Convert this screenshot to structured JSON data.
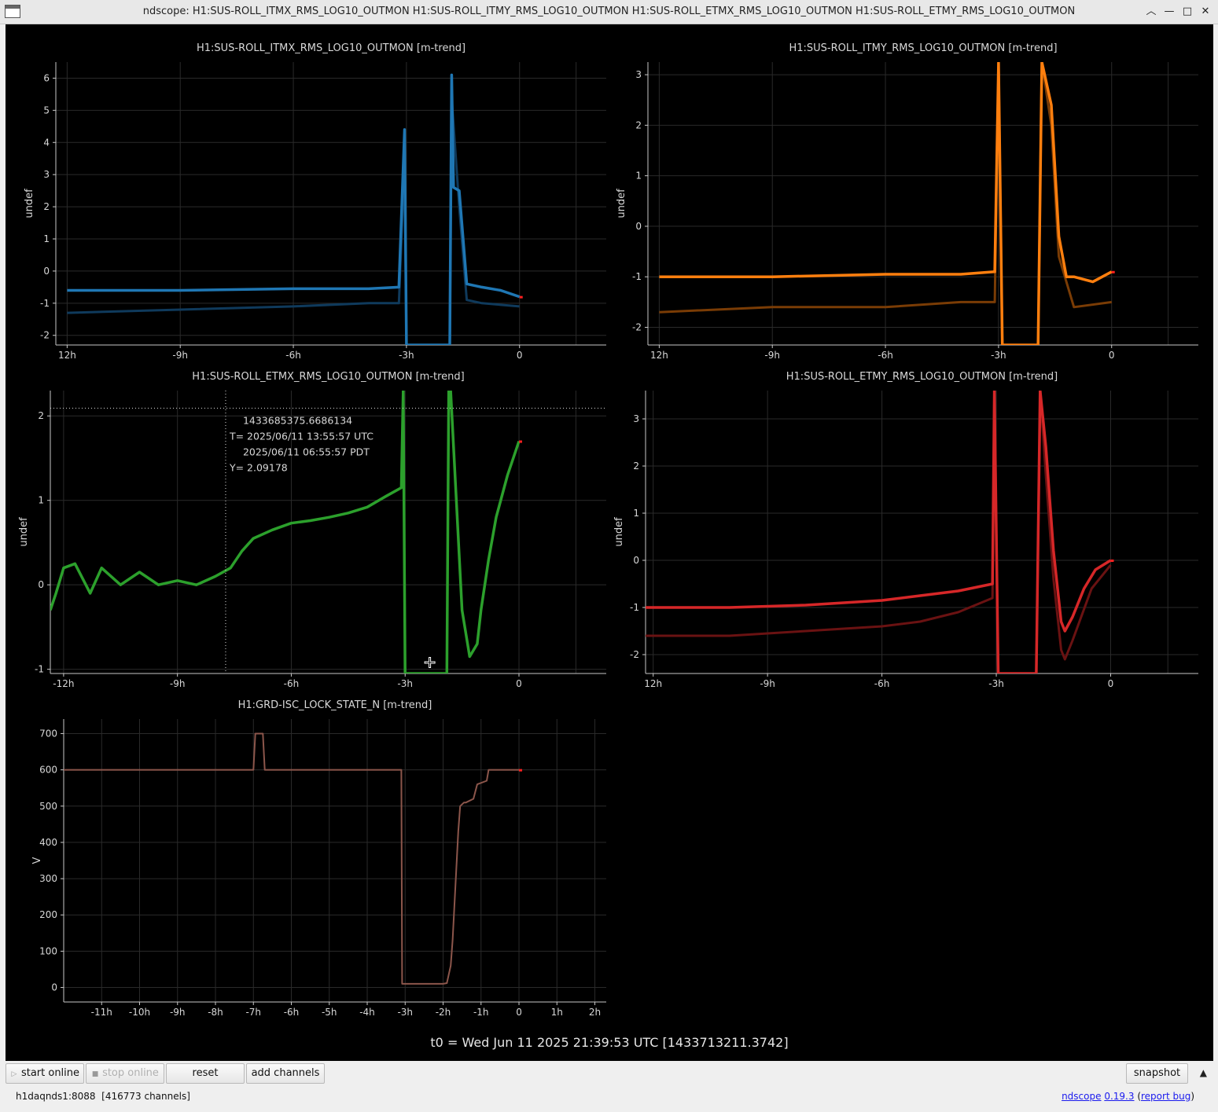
{
  "window": {
    "title": "ndscope: H1:SUS-ROLL_ITMX_RMS_LOG10_OUTMON H1:SUS-ROLL_ITMY_RMS_LOG10_OUTMON H1:SUS-ROLL_ETMX_RMS_LOG10_OUTMON H1:SUS-ROLL_ETMY_RMS_LOG10_OUTMON",
    "controls": [
      "︿",
      "—",
      "□",
      "✕"
    ]
  },
  "t0_label": "t0 = Wed Jun 11 2025 21:39:53 UTC [1433713211.3742]",
  "cursor_readout": {
    "gps": "1433685375.6686134",
    "utc": "T= 2025/06/11 13:55:57 UTC",
    "pdt": "2025/06/11 06:55:57 PDT",
    "y": "Y= 2.09178"
  },
  "buttons": {
    "start_online": "start online",
    "stop_online": "stop online",
    "reset": "reset",
    "add_channels": "add channels",
    "snapshot": "snapshot"
  },
  "status": {
    "server": "h1daqnds1:8088",
    "channels": "[416773 channels]",
    "app_name": "ndscope",
    "version": "0.19.3",
    "report_bug": "report bug"
  },
  "colors": {
    "itmx": "#1f77b4",
    "itmy": "#ff7f0e",
    "etmx": "#2ca02c",
    "etmy": "#d62728",
    "grd": "#8c564b",
    "background": "#000000",
    "text": "#d8d8d8"
  },
  "chart_data": [
    {
      "type": "line",
      "title": "H1:SUS-ROLL_ITMX_RMS_LOG10_OUTMON [m-trend]",
      "ylabel": "undef",
      "xlabel": "",
      "xlim": [
        -12.3,
        2.3
      ],
      "ylim": [
        -2.3,
        6.5
      ],
      "xticks": [
        -12,
        -9,
        -6,
        -3,
        0
      ],
      "xticklabels": [
        "12h",
        "-9h",
        "-6h",
        "-3h",
        "0"
      ],
      "yticks": [
        -2,
        -1,
        0,
        1,
        2,
        3,
        4,
        5,
        6
      ],
      "grid": true,
      "series": [
        {
          "role": "mean",
          "x": [
            -12,
            -9,
            -6,
            -4,
            -3.2,
            -3.05,
            -3,
            -2.95,
            -1.85,
            -1.8,
            -1.75,
            -1.6,
            -1.4,
            -1,
            -0.5,
            0
          ],
          "y": [
            -0.6,
            -0.6,
            -0.55,
            -0.55,
            -0.5,
            4.4,
            -2.3,
            -2.3,
            -2.3,
            6.1,
            2.6,
            2.5,
            -0.4,
            -0.5,
            -0.6,
            -0.8
          ]
        },
        {
          "role": "min",
          "x": [
            -12,
            -9,
            -6,
            -4,
            -3.2,
            -3.05,
            -3,
            -1.85,
            -1.8,
            -1.6,
            -1.4,
            -1,
            0
          ],
          "y": [
            -1.3,
            -1.2,
            -1.1,
            -1.0,
            -1.0,
            3.5,
            -2.3,
            -2.3,
            5.4,
            2.0,
            -0.9,
            -1.0,
            -1.1
          ]
        }
      ]
    },
    {
      "type": "line",
      "title": "H1:SUS-ROLL_ITMY_RMS_LOG10_OUTMON [m-trend]",
      "ylabel": "undef",
      "xlabel": "",
      "xlim": [
        -12.3,
        2.3
      ],
      "ylim": [
        -2.35,
        3.25
      ],
      "xticks": [
        -12,
        -9,
        -6,
        -3,
        0
      ],
      "xticklabels": [
        "12h",
        "-9h",
        "-6h",
        "-3h",
        "0"
      ],
      "yticks": [
        -2,
        -1,
        0,
        1,
        2,
        3
      ],
      "grid": true,
      "series": [
        {
          "role": "mean",
          "x": [
            -12,
            -9,
            -6,
            -4,
            -3.1,
            -3.0,
            -2.9,
            -1.95,
            -1.85,
            -1.6,
            -1.4,
            -1.2,
            -1,
            -0.5,
            0
          ],
          "y": [
            -1.0,
            -1.0,
            -0.95,
            -0.95,
            -0.9,
            3.25,
            -2.35,
            -2.35,
            3.25,
            2.4,
            -0.2,
            -1.0,
            -1.0,
            -1.1,
            -0.9
          ]
        },
        {
          "role": "min",
          "x": [
            -12,
            -9,
            -6,
            -4,
            -3.1,
            -3.0,
            -2.9,
            -1.95,
            -1.85,
            -1.6,
            -1.4,
            -1.0,
            0
          ],
          "y": [
            -1.7,
            -1.6,
            -1.6,
            -1.5,
            -1.5,
            3.25,
            -2.35,
            -2.35,
            3.25,
            2.0,
            -0.6,
            -1.6,
            -1.5
          ]
        }
      ]
    },
    {
      "type": "line",
      "title": "H1:SUS-ROLL_ETMX_RMS_LOG10_OUTMON [m-trend]",
      "ylabel": "undef",
      "xlabel": "",
      "xlim": [
        -12.35,
        2.3
      ],
      "ylim": [
        -1.05,
        2.3
      ],
      "xticks": [
        -12,
        -9,
        -6,
        -3,
        0
      ],
      "xticklabels": [
        "-12h",
        "-9h",
        "-6h",
        "-3h",
        "0"
      ],
      "yticks": [
        -1,
        0,
        1,
        2
      ],
      "grid": true,
      "series": [
        {
          "role": "mean",
          "x": [
            -12.35,
            -12.2,
            -12,
            -11.7,
            -11.3,
            -11,
            -10.5,
            -10,
            -9.5,
            -9,
            -8.5,
            -8,
            -7.6,
            -7.3,
            -7,
            -6.5,
            -6,
            -5.5,
            -5,
            -4.5,
            -4,
            -3.5,
            -3.1,
            -3.05,
            -3.0,
            -2.95,
            -1.9,
            -1.85,
            -1.8,
            -1.5,
            -1.3,
            -1.1,
            -1.0,
            -0.8,
            -0.6,
            -0.3,
            0
          ],
          "y": [
            -0.3,
            -0.1,
            0.2,
            0.25,
            -0.1,
            0.2,
            0.0,
            0.15,
            0.0,
            0.05,
            0.0,
            0.1,
            0.2,
            0.4,
            0.55,
            0.65,
            0.73,
            0.76,
            0.8,
            0.85,
            0.92,
            1.05,
            1.15,
            2.3,
            -1.05,
            -1.05,
            -1.05,
            2.3,
            2.3,
            -0.3,
            -0.85,
            -0.7,
            -0.3,
            0.3,
            0.8,
            1.3,
            1.7
          ]
        }
      ]
    },
    {
      "type": "line",
      "title": "H1:SUS-ROLL_ETMY_RMS_LOG10_OUTMON [m-trend]",
      "ylabel": "undef",
      "xlabel": "",
      "xlim": [
        -12.2,
        2.3
      ],
      "ylim": [
        -2.4,
        3.6
      ],
      "xticks": [
        -12,
        -9,
        -6,
        -3,
        0
      ],
      "xticklabels": [
        "12h",
        "-9h",
        "-6h",
        "-3h",
        "0"
      ],
      "yticks": [
        -2,
        -1,
        0,
        1,
        2,
        3
      ],
      "grid": true,
      "series": [
        {
          "role": "mean",
          "x": [
            -12.2,
            -10,
            -8,
            -6,
            -5,
            -4,
            -3.1,
            -3.05,
            -2.95,
            -1.95,
            -1.85,
            -1.7,
            -1.5,
            -1.3,
            -1.2,
            -1.0,
            -0.7,
            -0.4,
            0
          ],
          "y": [
            -1.0,
            -1.0,
            -0.95,
            -0.85,
            -0.75,
            -0.65,
            -0.5,
            3.6,
            -2.4,
            -2.4,
            3.6,
            2.4,
            0.2,
            -1.3,
            -1.5,
            -1.2,
            -0.6,
            -0.2,
            0.0
          ]
        },
        {
          "role": "min",
          "x": [
            -12.2,
            -10,
            -8,
            -6,
            -5,
            -4,
            -3.1,
            -3.05,
            -2.95,
            -1.95,
            -1.85,
            -1.7,
            -1.5,
            -1.3,
            -1.2,
            -1.0,
            -0.5,
            0
          ],
          "y": [
            -1.6,
            -1.6,
            -1.5,
            -1.4,
            -1.3,
            -1.1,
            -0.8,
            3.6,
            -2.4,
            -2.4,
            3.6,
            1.8,
            -0.4,
            -1.9,
            -2.1,
            -1.7,
            -0.6,
            -0.1
          ]
        }
      ]
    },
    {
      "type": "line",
      "title": "H1:GRD-ISC_LOCK_STATE_N [m-trend]",
      "ylabel": "V",
      "xlabel": "",
      "xlim": [
        -12,
        2.3
      ],
      "ylim": [
        -40,
        740
      ],
      "xticks": [
        -11,
        -10,
        -9,
        -8,
        -7,
        -6,
        -5,
        -4,
        -3,
        -2,
        -1,
        0,
        1,
        2
      ],
      "xticklabels": [
        "-11h",
        "-10h",
        "-9h",
        "-8h",
        "-7h",
        "-6h",
        "-5h",
        "-4h",
        "-3h",
        "-2h",
        "-1h",
        "0",
        "1h",
        "2h"
      ],
      "yticks": [
        0,
        100,
        200,
        300,
        400,
        500,
        600,
        700
      ],
      "grid": true,
      "series": [
        {
          "role": "mean",
          "x": [
            -12,
            -7.0,
            -6.95,
            -6.75,
            -6.7,
            -3.1,
            -3.08,
            -2.0,
            -1.9,
            -1.8,
            -1.75,
            -1.6,
            -1.55,
            -1.45,
            -1.4,
            -1.2,
            -1.1,
            -0.85,
            -0.8,
            0
          ],
          "y": [
            600,
            600,
            700,
            700,
            600,
            600,
            10,
            10,
            12,
            60,
            130,
            430,
            500,
            510,
            510,
            520,
            560,
            570,
            600,
            600
          ]
        }
      ]
    }
  ]
}
